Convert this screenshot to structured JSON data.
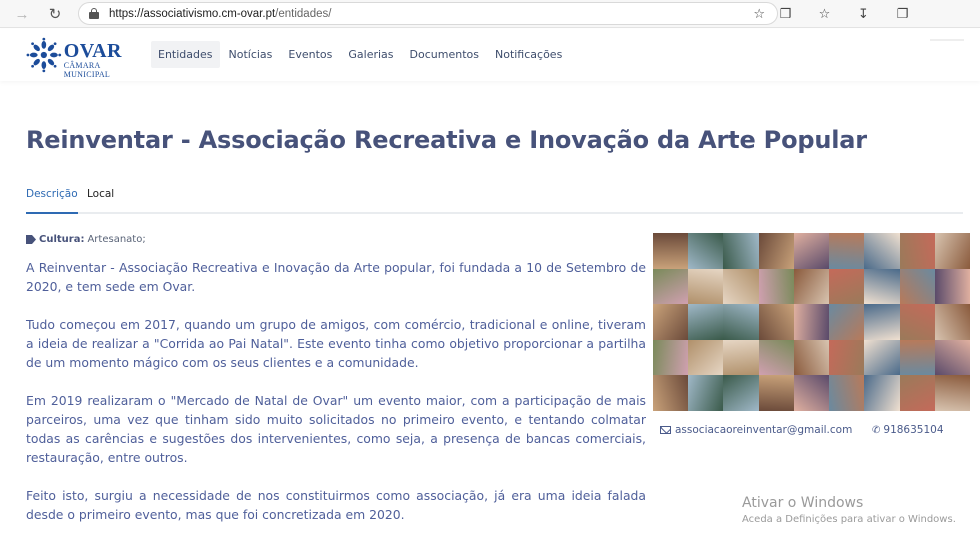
{
  "browser": {
    "url_host": "https://associativismo.cm-ovar.pt",
    "url_path": "/entidades/",
    "back_icon": "arrow-right-icon",
    "reload_icon": "reload-icon"
  },
  "site": {
    "logo_name": "OVAR",
    "logo_subtitle_1": "CÂMARA",
    "logo_subtitle_2": "MUNICIPAL",
    "brand_color": "#1c4c9a",
    "nav": [
      {
        "label": "Entidades",
        "active": true
      },
      {
        "label": "Notícias"
      },
      {
        "label": "Eventos"
      },
      {
        "label": "Galerias"
      },
      {
        "label": "Documentos"
      },
      {
        "label": "Notificações"
      }
    ]
  },
  "page": {
    "title": "Reinventar - Associação Recreativa e Inovação da Arte Popular",
    "tabs": [
      {
        "label": "Descrição",
        "active": true
      },
      {
        "label": "Local"
      }
    ],
    "category_label": "Cultura:",
    "category_value": "Artesanato;",
    "paragraphs": [
      "A Reinventar - Associação Recreativa e Inovação da Arte popular, foi fundada a 10 de Setembro de 2020, e tem sede em Ovar.",
      "Tudo começou em 2017, quando um grupo de amigos, com comércio, tradicional e online, tiveram a ideia de realizar a \"Corrida ao Pai Natal\". Este evento tinha como objetivo proporcionar a partilha de um momento mágico com os seus clientes e a comunidade.",
      "Em 2019 realizaram o \"Mercado de Natal de Ovar\" um evento maior, com a participação de mais parceiros, uma vez que tinham sido muito solicitados no primeiro evento, e tentando colmatar todas as carências e sugestões dos intervenientes, como seja, a presença de bancas comerciais, restauração, entre outros.",
      "Feito isto, surgiu a necessidade de nos constituirmos como associação, já era uma ideia falada desde o primeiro evento, mas que foi concretizada em 2020."
    ],
    "email": "associacaoreinventar@gmail.com",
    "phone": "918635104",
    "accent_color": "#47527a"
  },
  "watermark": {
    "title": "Ativar o Windows",
    "subtitle": "Aceda a Definições para ativar o Windows."
  }
}
